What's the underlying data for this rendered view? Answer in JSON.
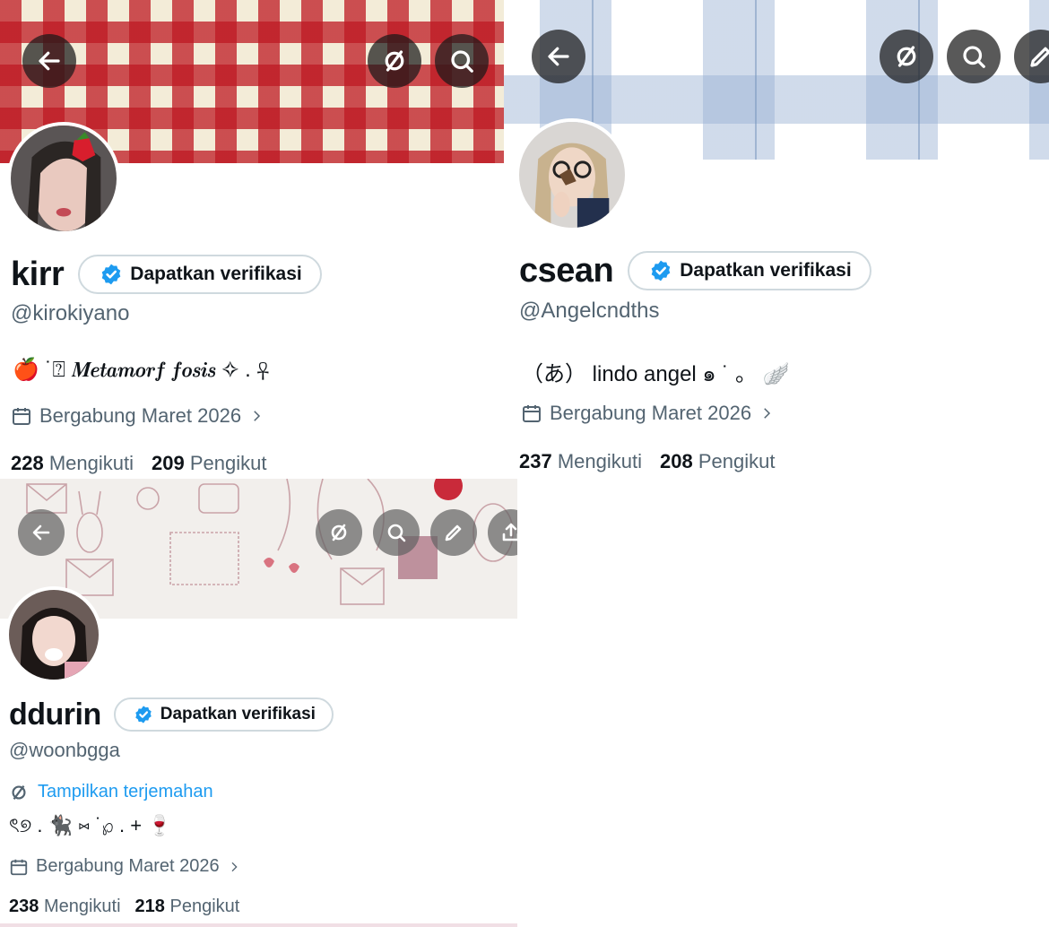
{
  "profiles": [
    {
      "display_name": "kirr",
      "handle": "@kirokiyano",
      "verify_label": "Dapatkan verifikasi",
      "bio": "🍎 ˙⍰ 𝑴𝒆𝒕𝒂𝒎𝒐𝒓𝒇 𝒇𝒐𝒔𝒊𝒔 ✧ . ☥",
      "joined": "Bergabung Maret 2026",
      "following_count": "228",
      "following_label": "Mengikuti",
      "followers_count": "209",
      "followers_label": "Pengikut"
    },
    {
      "display_name": "csean",
      "handle": "@Angelcndths",
      "verify_label": "Dapatkan verifikasi",
      "bio": "（あ） lindo angel ๑ ˙ 。 🪽",
      "joined": "Bergabung Maret 2026",
      "following_count": "237",
      "following_label": "Mengikuti",
      "followers_count": "208",
      "followers_label": "Pengikut"
    },
    {
      "display_name": "ddurin",
      "handle": "@woonbgga",
      "verify_label": "Dapatkan verifikasi",
      "translate_label": "Tampilkan terjemahan",
      "bio": "ৎ୭ . 🐈‍⬛ ⑅ ˙℘ . + 🍷",
      "joined": "Bergabung Maret 2026",
      "following_count": "238",
      "following_label": "Mengikuti",
      "followers_count": "218",
      "followers_label": "Pengikut"
    }
  ],
  "icons": {
    "back": "back-arrow-icon",
    "no_grok": "slashed-circle-icon",
    "search": "search-icon",
    "edit": "pencil-icon",
    "share": "share-icon",
    "verified": "verified-badge-icon",
    "calendar": "calendar-icon",
    "chevron": "chevron-right-icon"
  },
  "colors": {
    "accent": "#1d9bf0",
    "secondary_text": "#536471",
    "primary_text": "#0f1419"
  }
}
